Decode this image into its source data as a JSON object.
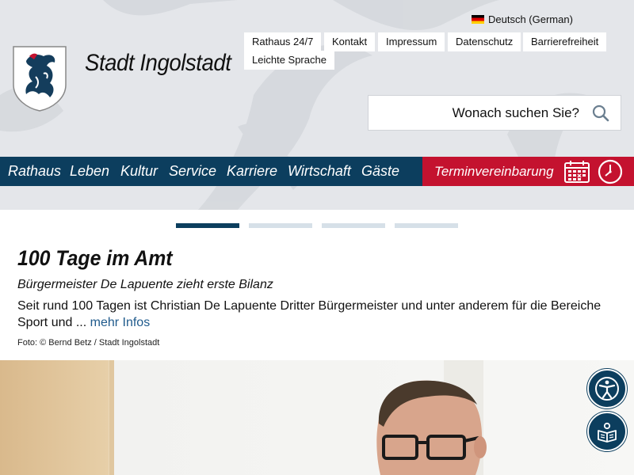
{
  "header": {
    "language": "Deutsch (German)",
    "top_links": [
      "Rathaus 24/7",
      "Kontakt",
      "Impressum",
      "Datenschutz",
      "Barrierefreiheit",
      "Leichte Sprache"
    ],
    "brand": "Stadt Ingolstadt",
    "search_placeholder": "Wonach suchen Sie?"
  },
  "nav": {
    "items": [
      "Rathaus",
      "Leben",
      "Kultur",
      "Service",
      "Karriere",
      "Wirtschaft",
      "Gäste"
    ],
    "termin": "Terminvereinbarung"
  },
  "slider": {
    "total": 4,
    "active": 1
  },
  "article": {
    "title": "100 Tage im Amt",
    "subtitle": "Bürgermeister De Lapuente zieht erste Bilanz",
    "body": "Seit rund 100 Tagen ist Christian De Lapuente Dritter Bürgermeister und unter anderem für die Bereiche Sport und ... ",
    "more": "mehr Infos",
    "credit": "Foto: © Bernd Betz / Stadt Ingolstadt"
  },
  "colors": {
    "primary": "#0c3e5e",
    "accent": "#c4122f",
    "link": "#1f5a8c"
  },
  "icons": [
    "flag-de-icon",
    "city-crest-icon",
    "search-icon",
    "calendar-icon",
    "clock-icon",
    "accessibility-icon",
    "easy-read-icon"
  ]
}
